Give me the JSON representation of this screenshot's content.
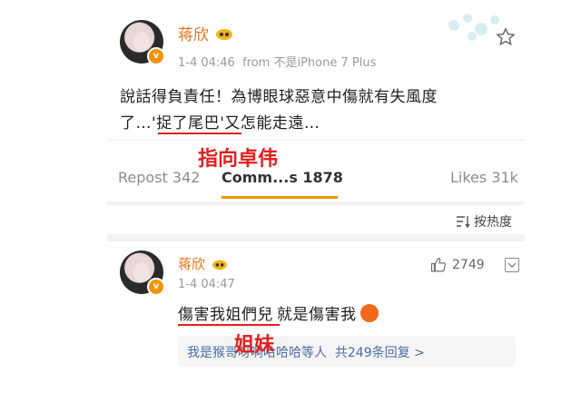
{
  "post": {
    "author": "蒋欣",
    "meta": "1-4 04:46  from 不是iPhone 7 Plus",
    "text_line1": "說話得負責任！為博眼球惡意中傷就有失風度",
    "text_line2_pre": "了…'",
    "text_highlight": "捉了尾巴",
    "text_line2_post": "'又怎能走遠…",
    "annotation": "指向卓伟"
  },
  "tabs": {
    "repost": "Repost 342",
    "comments": "Comm...s 1878",
    "likes": "Likes 31k"
  },
  "sort": {
    "label": "按热度"
  },
  "comment": {
    "author": "蒋欣",
    "time": "1-4 04:47",
    "like_count": "2749",
    "text_highlight": "傷害我姐們兒",
    "text_rest": "就是傷害我",
    "annotation": "姐妹",
    "replies": "我是猴哥呀啊哈哈哈等人  共249条回复 >"
  },
  "colors": {
    "name": "#e8711c",
    "annotation": "#e02020",
    "accent": "#f29400"
  }
}
